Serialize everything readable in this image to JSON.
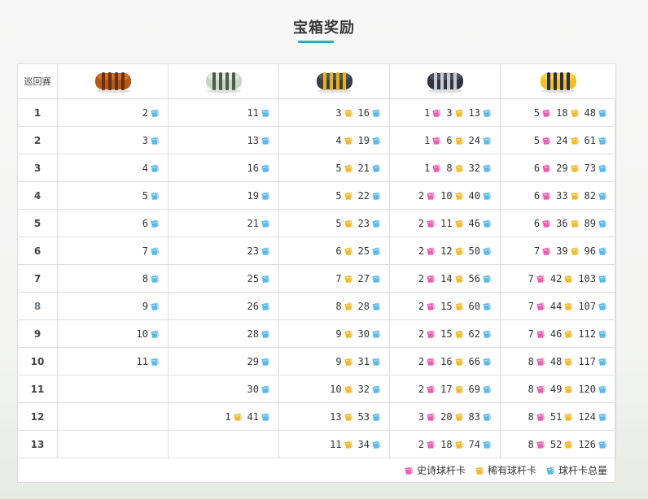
{
  "title": "宝箱奖励",
  "corner_label": "巡回赛",
  "colors": {
    "accent": "#2ea8c7",
    "epic_card": "#e85cb3",
    "rare_card": "#f2b92c",
    "total_card": "#59b8e8"
  },
  "chests": [
    {
      "name": "bronze-chest-icon",
      "body": "#b5581c",
      "band": "#6b2f0a",
      "shade": "#d8782a"
    },
    {
      "name": "silver-chest-icon",
      "body": "#c9d6c0",
      "band": "#4b5b50",
      "shade": "#e6eedc"
    },
    {
      "name": "gold-chest-icon",
      "body": "#3a3f46",
      "band": "#e8b21e",
      "shade": "#5a6068"
    },
    {
      "name": "platinum-chest-icon",
      "body": "#2f3540",
      "band": "#c8ccd2",
      "shade": "#525a66"
    },
    {
      "name": "legendary-chest-icon",
      "body": "#f0c21e",
      "band": "#2a2a52",
      "shade": "#ffd84a"
    }
  ],
  "rows": [
    {
      "round": "1",
      "muted": false,
      "cells": [
        [
          {
            "v": "2",
            "t": "total"
          }
        ],
        [
          {
            "v": "11",
            "t": "total"
          }
        ],
        [
          {
            "v": "3",
            "t": "rare"
          },
          {
            "v": "16",
            "t": "total"
          }
        ],
        [
          {
            "v": "1",
            "t": "epic"
          },
          {
            "v": "3",
            "t": "rare"
          },
          {
            "v": "13",
            "t": "total"
          }
        ],
        [
          {
            "v": "5",
            "t": "epic"
          },
          {
            "v": "18",
            "t": "rare"
          },
          {
            "v": "48",
            "t": "total"
          }
        ]
      ]
    },
    {
      "round": "2",
      "muted": false,
      "cells": [
        [
          {
            "v": "3",
            "t": "total"
          }
        ],
        [
          {
            "v": "13",
            "t": "total"
          }
        ],
        [
          {
            "v": "4",
            "t": "rare"
          },
          {
            "v": "19",
            "t": "total"
          }
        ],
        [
          {
            "v": "1",
            "t": "epic"
          },
          {
            "v": "6",
            "t": "rare"
          },
          {
            "v": "24",
            "t": "total"
          }
        ],
        [
          {
            "v": "5",
            "t": "epic"
          },
          {
            "v": "24",
            "t": "rare"
          },
          {
            "v": "61",
            "t": "total"
          }
        ]
      ]
    },
    {
      "round": "3",
      "muted": false,
      "cells": [
        [
          {
            "v": "4",
            "t": "total"
          }
        ],
        [
          {
            "v": "16",
            "t": "total"
          }
        ],
        [
          {
            "v": "5",
            "t": "rare"
          },
          {
            "v": "21",
            "t": "total"
          }
        ],
        [
          {
            "v": "1",
            "t": "epic"
          },
          {
            "v": "8",
            "t": "rare"
          },
          {
            "v": "32",
            "t": "total"
          }
        ],
        [
          {
            "v": "6",
            "t": "epic"
          },
          {
            "v": "29",
            "t": "rare"
          },
          {
            "v": "73",
            "t": "total"
          }
        ]
      ]
    },
    {
      "round": "4",
      "muted": false,
      "cells": [
        [
          {
            "v": "5",
            "t": "total"
          }
        ],
        [
          {
            "v": "19",
            "t": "total"
          }
        ],
        [
          {
            "v": "5",
            "t": "rare"
          },
          {
            "v": "22",
            "t": "total"
          }
        ],
        [
          {
            "v": "2",
            "t": "epic"
          },
          {
            "v": "10",
            "t": "rare"
          },
          {
            "v": "40",
            "t": "total"
          }
        ],
        [
          {
            "v": "6",
            "t": "epic"
          },
          {
            "v": "33",
            "t": "rare"
          },
          {
            "v": "82",
            "t": "total"
          }
        ]
      ]
    },
    {
      "round": "5",
      "muted": false,
      "cells": [
        [
          {
            "v": "6",
            "t": "total"
          }
        ],
        [
          {
            "v": "21",
            "t": "total"
          }
        ],
        [
          {
            "v": "5",
            "t": "rare"
          },
          {
            "v": "23",
            "t": "total"
          }
        ],
        [
          {
            "v": "2",
            "t": "epic"
          },
          {
            "v": "11",
            "t": "rare"
          },
          {
            "v": "46",
            "t": "total"
          }
        ],
        [
          {
            "v": "6",
            "t": "epic"
          },
          {
            "v": "36",
            "t": "rare"
          },
          {
            "v": "89",
            "t": "total"
          }
        ]
      ]
    },
    {
      "round": "6",
      "muted": false,
      "cells": [
        [
          {
            "v": "7",
            "t": "total"
          }
        ],
        [
          {
            "v": "23",
            "t": "total"
          }
        ],
        [
          {
            "v": "6",
            "t": "rare"
          },
          {
            "v": "25",
            "t": "total"
          }
        ],
        [
          {
            "v": "2",
            "t": "epic"
          },
          {
            "v": "12",
            "t": "rare"
          },
          {
            "v": "50",
            "t": "total"
          }
        ],
        [
          {
            "v": "7",
            "t": "epic"
          },
          {
            "v": "39",
            "t": "rare"
          },
          {
            "v": "96",
            "t": "total"
          }
        ]
      ]
    },
    {
      "round": "7",
      "muted": false,
      "cells": [
        [
          {
            "v": "8",
            "t": "total"
          }
        ],
        [
          {
            "v": "25",
            "t": "total"
          }
        ],
        [
          {
            "v": "7",
            "t": "rare"
          },
          {
            "v": "27",
            "t": "total"
          }
        ],
        [
          {
            "v": "2",
            "t": "epic"
          },
          {
            "v": "14",
            "t": "rare"
          },
          {
            "v": "56",
            "t": "total"
          }
        ],
        [
          {
            "v": "7",
            "t": "epic"
          },
          {
            "v": "42",
            "t": "rare"
          },
          {
            "v": "103",
            "t": "total"
          }
        ]
      ]
    },
    {
      "round": "8",
      "muted": true,
      "cells": [
        [
          {
            "v": "9",
            "t": "total"
          }
        ],
        [
          {
            "v": "26",
            "t": "total"
          }
        ],
        [
          {
            "v": "8",
            "t": "rare"
          },
          {
            "v": "28",
            "t": "total"
          }
        ],
        [
          {
            "v": "2",
            "t": "epic"
          },
          {
            "v": "15",
            "t": "rare"
          },
          {
            "v": "60",
            "t": "total"
          }
        ],
        [
          {
            "v": "7",
            "t": "epic"
          },
          {
            "v": "44",
            "t": "rare"
          },
          {
            "v": "107",
            "t": "total"
          }
        ]
      ]
    },
    {
      "round": "9",
      "muted": false,
      "cells": [
        [
          {
            "v": "10",
            "t": "total"
          }
        ],
        [
          {
            "v": "28",
            "t": "total"
          }
        ],
        [
          {
            "v": "9",
            "t": "rare"
          },
          {
            "v": "30",
            "t": "total"
          }
        ],
        [
          {
            "v": "2",
            "t": "epic"
          },
          {
            "v": "15",
            "t": "rare"
          },
          {
            "v": "62",
            "t": "total"
          }
        ],
        [
          {
            "v": "7",
            "t": "epic"
          },
          {
            "v": "46",
            "t": "rare"
          },
          {
            "v": "112",
            "t": "total"
          }
        ]
      ]
    },
    {
      "round": "10",
      "muted": false,
      "cells": [
        [
          {
            "v": "11",
            "t": "total"
          }
        ],
        [
          {
            "v": "29",
            "t": "total"
          }
        ],
        [
          {
            "v": "9",
            "t": "rare"
          },
          {
            "v": "31",
            "t": "total"
          }
        ],
        [
          {
            "v": "2",
            "t": "epic"
          },
          {
            "v": "16",
            "t": "rare"
          },
          {
            "v": "66",
            "t": "total"
          }
        ],
        [
          {
            "v": "8",
            "t": "epic"
          },
          {
            "v": "48",
            "t": "rare"
          },
          {
            "v": "117",
            "t": "total"
          }
        ]
      ]
    },
    {
      "round": "11",
      "muted": false,
      "cells": [
        [],
        [
          {
            "v": "30",
            "t": "total"
          }
        ],
        [
          {
            "v": "10",
            "t": "rare"
          },
          {
            "v": "32",
            "t": "total"
          }
        ],
        [
          {
            "v": "2",
            "t": "epic"
          },
          {
            "v": "17",
            "t": "rare"
          },
          {
            "v": "69",
            "t": "total"
          }
        ],
        [
          {
            "v": "8",
            "t": "epic"
          },
          {
            "v": "49",
            "t": "rare"
          },
          {
            "v": "120",
            "t": "total"
          }
        ]
      ]
    },
    {
      "round": "12",
      "muted": false,
      "cells": [
        [],
        [
          {
            "v": "1",
            "t": "rare"
          },
          {
            "v": "41",
            "t": "total"
          }
        ],
        [
          {
            "v": "13",
            "t": "rare"
          },
          {
            "v": "53",
            "t": "total"
          }
        ],
        [
          {
            "v": "3",
            "t": "epic"
          },
          {
            "v": "20",
            "t": "rare"
          },
          {
            "v": "83",
            "t": "total"
          }
        ],
        [
          {
            "v": "8",
            "t": "epic"
          },
          {
            "v": "51",
            "t": "rare"
          },
          {
            "v": "124",
            "t": "total"
          }
        ]
      ]
    },
    {
      "round": "13",
      "muted": false,
      "cells": [
        [],
        [],
        [
          {
            "v": "11",
            "t": "rare"
          },
          {
            "v": "34",
            "t": "total"
          }
        ],
        [
          {
            "v": "2",
            "t": "epic"
          },
          {
            "v": "18",
            "t": "rare"
          },
          {
            "v": "74",
            "t": "total"
          }
        ],
        [
          {
            "v": "8",
            "t": "epic"
          },
          {
            "v": "52",
            "t": "rare"
          },
          {
            "v": "126",
            "t": "total"
          }
        ]
      ]
    }
  ],
  "legend": [
    {
      "type": "epic",
      "icon": "epic-card-icon",
      "label": "史诗球杆卡"
    },
    {
      "type": "rare",
      "icon": "rare-card-icon",
      "label": "稀有球杆卡"
    },
    {
      "type": "total",
      "icon": "total-card-icon",
      "label": "球杆卡总量"
    }
  ]
}
